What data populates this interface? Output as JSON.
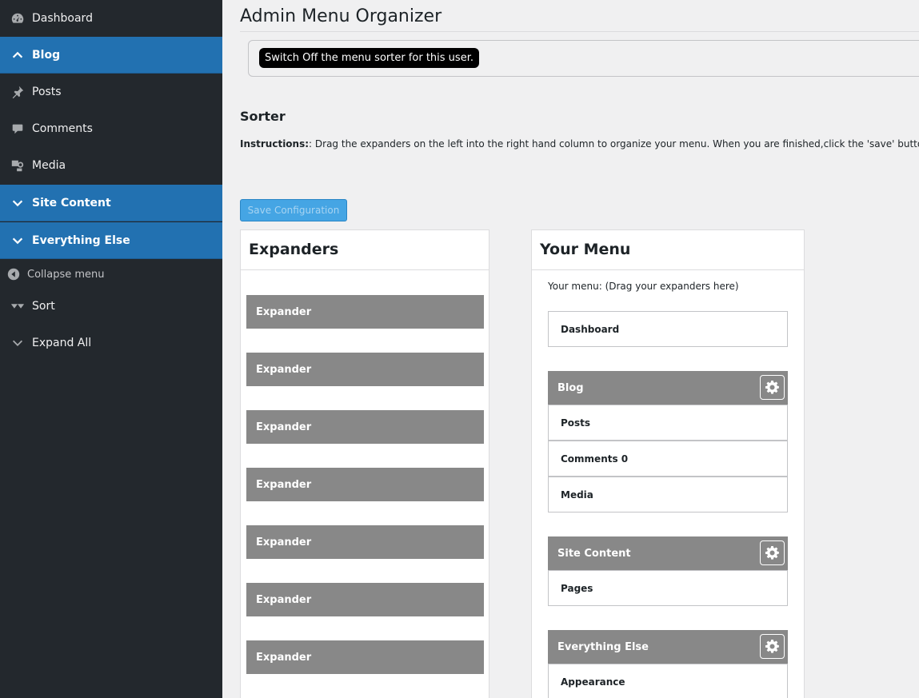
{
  "sidebar": {
    "items": [
      {
        "label": "Dashboard",
        "icon": "dashboard-icon"
      },
      {
        "label": "Blog",
        "icon": "chevron-up-icon"
      },
      {
        "label": "Posts",
        "icon": "pin-icon"
      },
      {
        "label": "Comments",
        "icon": "comment-icon"
      },
      {
        "label": "Media",
        "icon": "media-icon"
      },
      {
        "label": "Site Content",
        "icon": "chevron-down-icon"
      },
      {
        "label": "Everything Else",
        "icon": "chevron-down-icon"
      },
      {
        "label": "Collapse menu",
        "icon": "collapse-icon"
      },
      {
        "label": "Sort",
        "icon": "sort-icon"
      },
      {
        "label": "Expand All",
        "icon": "chevron-down-icon"
      }
    ]
  },
  "main": {
    "title": "Admin Menu Organizer",
    "switch_label": "Switch Off the menu sorter for this user.",
    "sorter_heading": "Sorter",
    "instructions_label": "Instructions:",
    "instructions_text": ": Drag the expanders on the left into the right hand column to organize your menu. When you are finished,click the 'save' button.",
    "save_label": "Save Configuration"
  },
  "expanders": {
    "heading": "Expanders",
    "items": [
      "Expander",
      "Expander",
      "Expander",
      "Expander",
      "Expander",
      "Expander",
      "Expander"
    ]
  },
  "your_menu": {
    "heading": "Your Menu",
    "hint": "Your menu: (Drag your expanders here)",
    "dashboard": "Dashboard",
    "groups": [
      {
        "label": "Blog",
        "items": [
          "Posts",
          "Comments 0",
          "Media"
        ]
      },
      {
        "label": "Site Content",
        "items": [
          "Pages"
        ]
      },
      {
        "label": "Everything Else",
        "items": [
          "Appearance"
        ]
      }
    ]
  },
  "colors": {
    "sidebar_bg": "#23282d",
    "group_bg": "#2271b1",
    "expander_bg": "#888888",
    "save_button_bg": "#45a5e4"
  }
}
